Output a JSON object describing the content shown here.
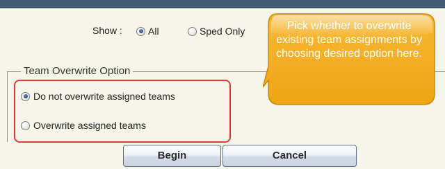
{
  "show": {
    "label": "Show :",
    "options": [
      {
        "label": "All",
        "selected": true
      },
      {
        "label": "Sped Only",
        "selected": false
      }
    ]
  },
  "overwrite": {
    "legend": "Team Overwrite Option",
    "options": [
      {
        "label": "Do not overwrite assigned teams",
        "selected": true
      },
      {
        "label": "Overwrite assigned teams",
        "selected": false
      }
    ]
  },
  "buttons": {
    "begin_label": "Begin",
    "cancel_label": "Cancel"
  },
  "callout": {
    "text": "Pick whether to overwrite existing team assignments by choosing desired option here."
  },
  "colors": {
    "header_bar": "#3f5a74",
    "background": "#f5f5e9",
    "highlight_box": "#e23a3a",
    "callout_fill": "#f3a81a"
  }
}
